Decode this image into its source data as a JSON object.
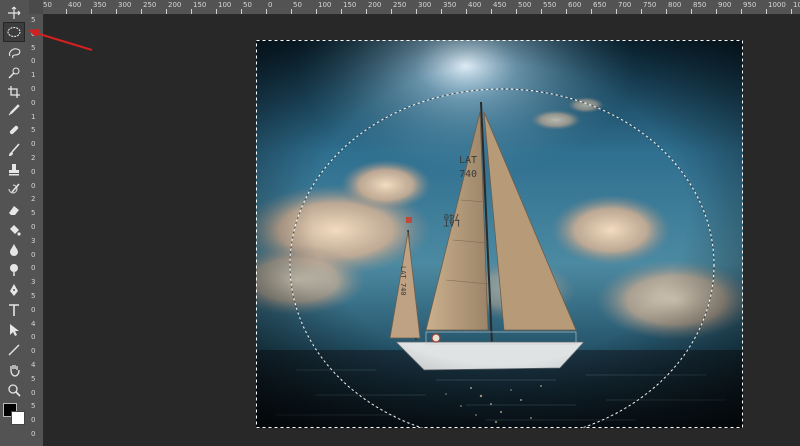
{
  "toolbar": {
    "active_tool": "elliptical-marquee-tool",
    "tools": [
      {
        "name": "move-tool",
        "icon": "move-icon"
      },
      {
        "name": "elliptical-marquee-tool",
        "icon": "ellipse-select-icon"
      },
      {
        "name": "lasso-tool",
        "icon": "lasso-icon"
      },
      {
        "name": "quick-selection-tool",
        "icon": "quick-select-icon"
      },
      {
        "name": "crop-tool",
        "icon": "crop-icon"
      },
      {
        "name": "eyedropper-tool",
        "icon": "eyedropper-icon"
      },
      {
        "name": "spot-healing-tool",
        "icon": "healing-icon"
      },
      {
        "name": "brush-tool",
        "icon": "brush-icon"
      },
      {
        "name": "clone-stamp-tool",
        "icon": "stamp-icon"
      },
      {
        "name": "history-brush-tool",
        "icon": "history-brush-icon"
      },
      {
        "name": "eraser-tool",
        "icon": "eraser-icon"
      },
      {
        "name": "paint-bucket-tool",
        "icon": "bucket-icon"
      },
      {
        "name": "blur-tool",
        "icon": "blur-icon"
      },
      {
        "name": "dodge-tool",
        "icon": "dodge-icon"
      },
      {
        "name": "pen-tool",
        "icon": "pen-icon"
      },
      {
        "name": "type-tool",
        "icon": "type-icon"
      },
      {
        "name": "path-selection-tool",
        "icon": "path-select-icon"
      },
      {
        "name": "line-tool",
        "icon": "line-icon"
      },
      {
        "name": "hand-tool",
        "icon": "hand-icon"
      },
      {
        "name": "zoom-tool",
        "icon": "zoom-icon"
      }
    ],
    "foreground_color": "#000000",
    "background_color": "#ffffff"
  },
  "rulers": {
    "horizontal_labels": [
      "50",
      "400",
      "350",
      "300",
      "250",
      "200",
      "150",
      "100",
      "50",
      "0",
      "50",
      "100",
      "150",
      "200",
      "250",
      "300",
      "350",
      "400",
      "450",
      "500",
      "550",
      "600",
      "650",
      "700",
      "750",
      "800",
      "850",
      "900",
      "950",
      "1000",
      "1050",
      "1100"
    ],
    "vertical_labels": [
      "5",
      "0",
      "5",
      "0",
      "1",
      "0",
      "0",
      "1",
      "5",
      "0",
      "2",
      "0",
      "0",
      "2",
      "5",
      "0",
      "3",
      "0",
      "0",
      "3",
      "5",
      "0",
      "4",
      "0",
      "0",
      "4",
      "5",
      "0",
      "5",
      "0",
      "0"
    ]
  },
  "canvas": {
    "image": "sailboat-at-sea-photo",
    "sail_text_main": "LAT\n740",
    "sail_text_main_2": "LAT\n740",
    "sail_text_jib": "LAT\n740",
    "selection": "elliptical-marquee"
  },
  "annotation": {
    "arrow_color": "#d42020"
  }
}
